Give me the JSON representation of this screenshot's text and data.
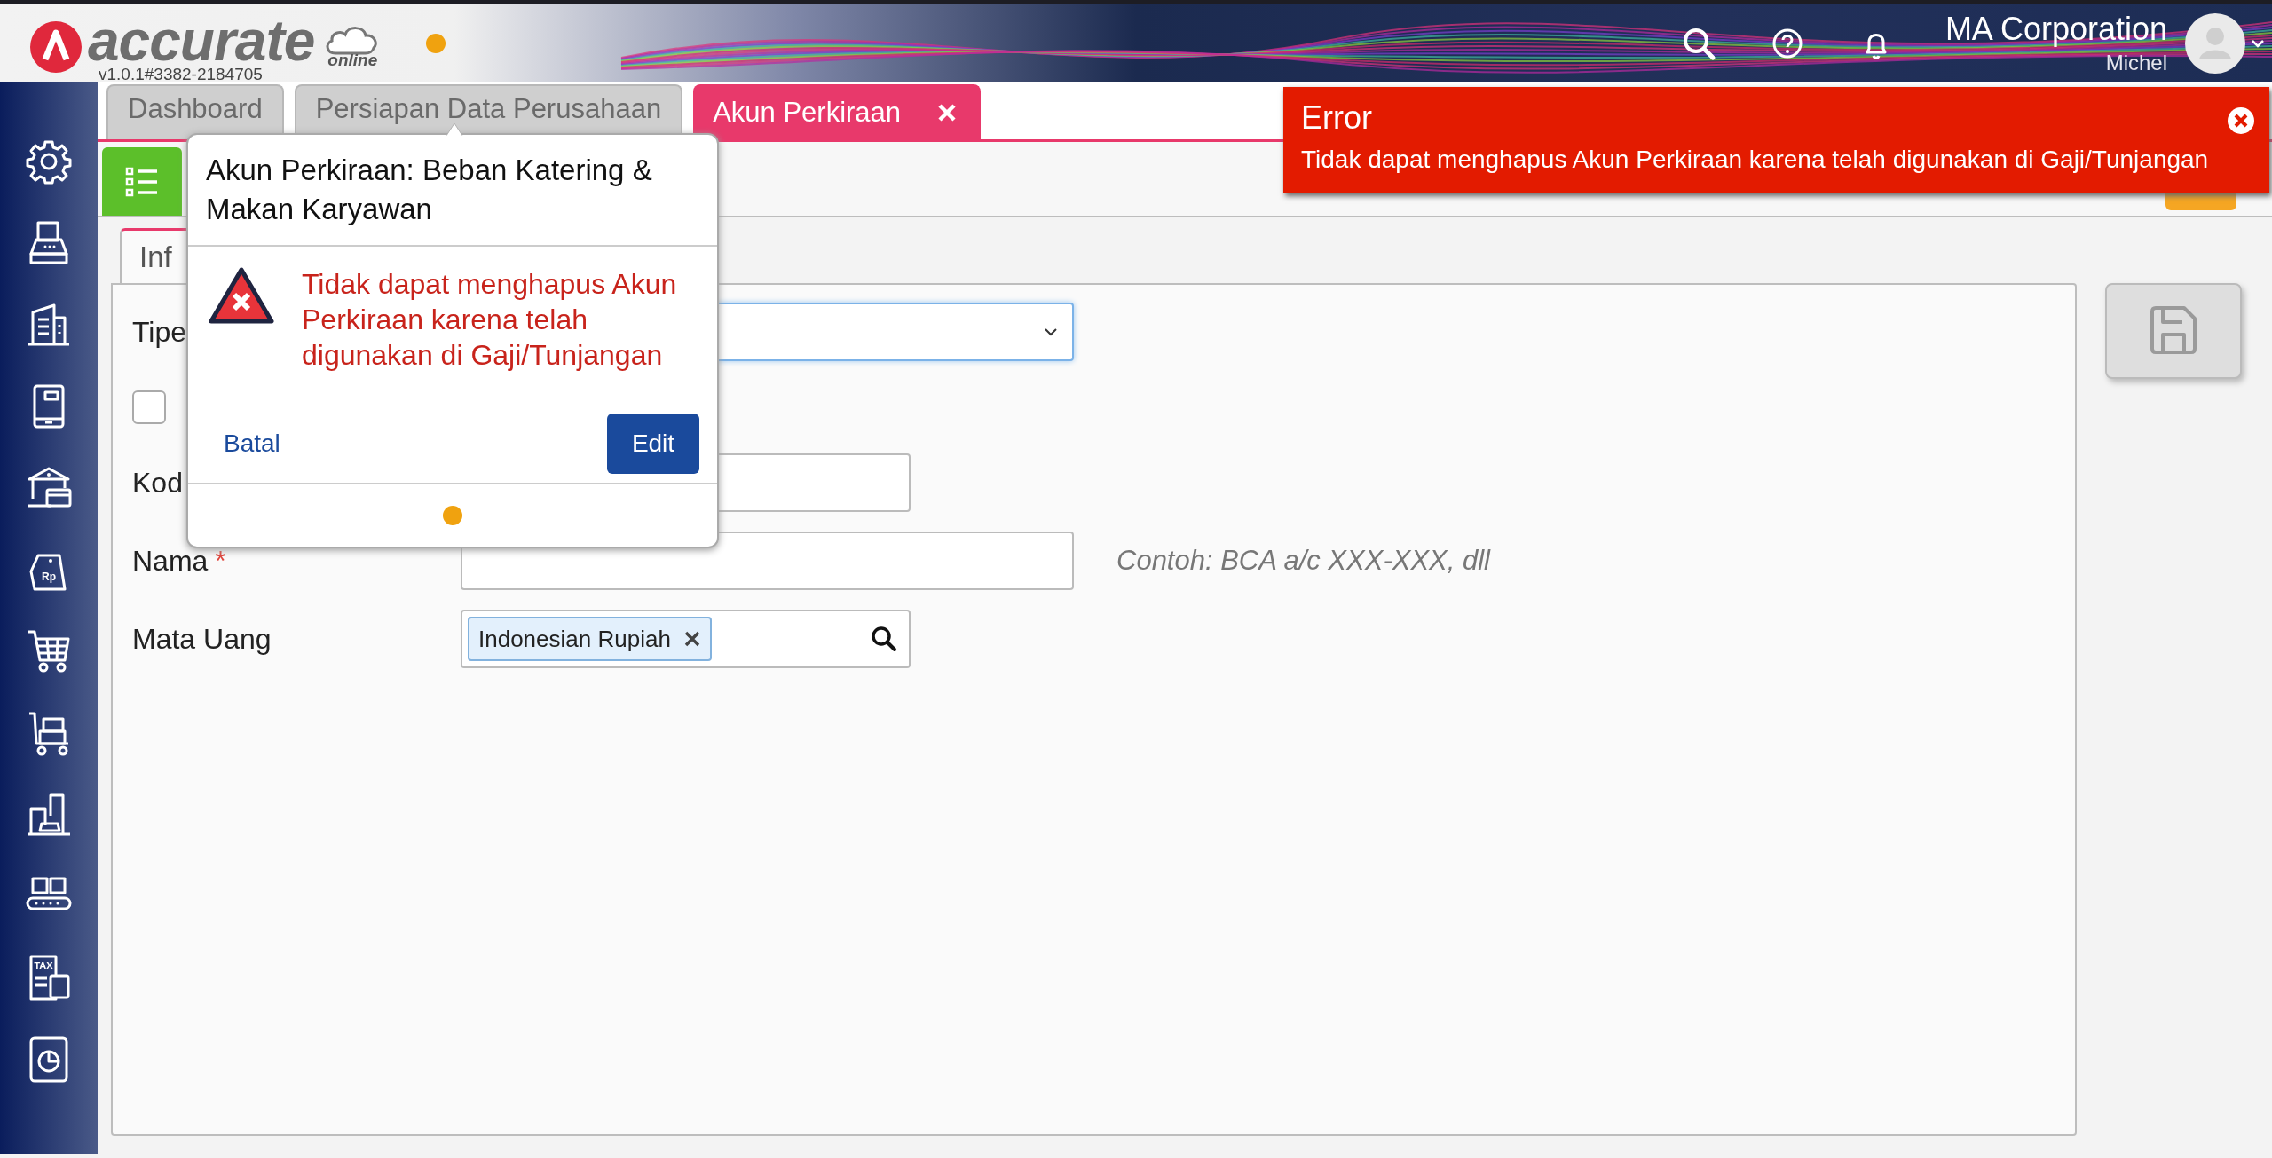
{
  "app": {
    "logo_text": "accurate",
    "logo_sub": "online",
    "version": "v1.0.1#3382-2184705"
  },
  "user": {
    "company": "MA Corporation",
    "name": "Michel"
  },
  "sidebar": {
    "tag_icon_text": "Rp",
    "tax_icon_text": "TAX"
  },
  "tabs": [
    {
      "label": "Dashboard",
      "selected": false,
      "closable": false
    },
    {
      "label": "Persiapan Data Perusahaan",
      "selected": false,
      "closable": false
    },
    {
      "label": "Akun Perkiraan",
      "selected": true,
      "closable": true
    }
  ],
  "subtabs": [
    {
      "label": "Inf",
      "selected": true
    }
  ],
  "form": {
    "fields": [
      {
        "kind": "select",
        "label": "Tipe",
        "focused": true
      },
      {
        "kind": "checkbox",
        "checked": false
      },
      {
        "kind": "text",
        "label": "Kod"
      },
      {
        "kind": "text",
        "label": "Nama",
        "required_mark": "*",
        "hint": "Contoh: BCA a/c XXX-XXX, dll"
      },
      {
        "kind": "tags",
        "label": "Mata Uang",
        "tags": [
          "Indonesian Rupiah"
        ]
      }
    ]
  },
  "save_button": {
    "disabled": true
  },
  "popup": {
    "title": "Akun Perkiraan: Beban Katering & Makan Karyawan",
    "message": "Tidak dapat menghapus Akun Perkiraan karena telah digunakan di Gaji/Tunjangan",
    "cancel": "Batal",
    "confirm": "Edit"
  },
  "toast": {
    "title": "Error",
    "message": "Tidak dapat menghapus Akun Perkiraan karena telah digunakan di Gaji/Tunjangan"
  }
}
